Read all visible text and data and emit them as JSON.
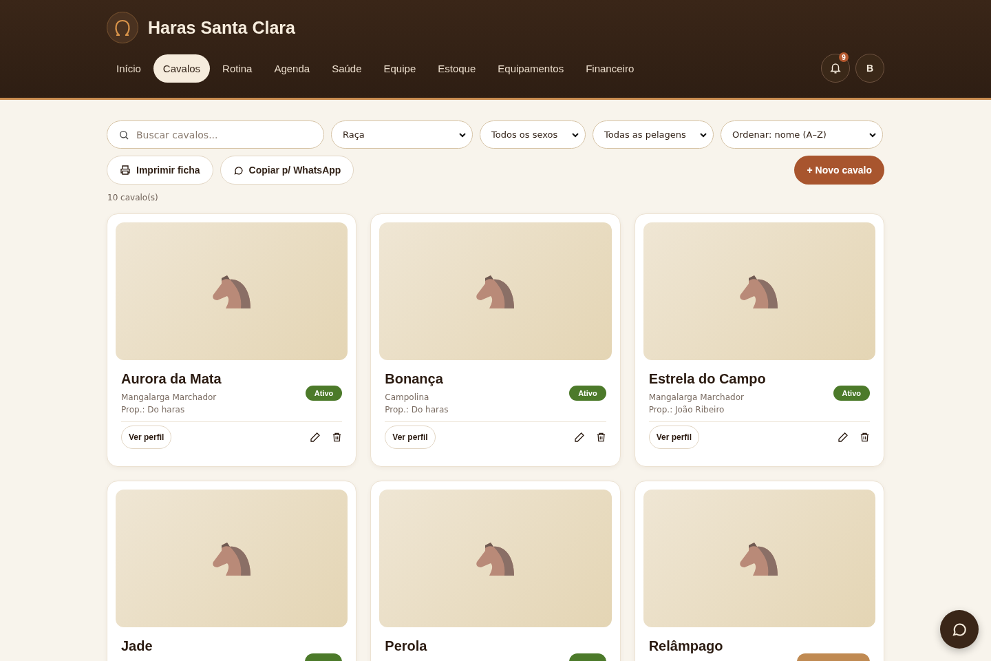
{
  "brand": {
    "title": "Haras Santa Clara"
  },
  "nav": [
    {
      "label": "Início",
      "selected": false
    },
    {
      "label": "Cavalos",
      "selected": true
    },
    {
      "label": "Rotina",
      "selected": false
    },
    {
      "label": "Agenda",
      "selected": false
    },
    {
      "label": "Saúde",
      "selected": false
    },
    {
      "label": "Equipe",
      "selected": false
    },
    {
      "label": "Estoque",
      "selected": false
    },
    {
      "label": "Equipamentos",
      "selected": false
    },
    {
      "label": "Financeiro",
      "selected": false
    }
  ],
  "notifications": {
    "count": "9"
  },
  "avatar": {
    "initial": "B"
  },
  "filters": {
    "search": {
      "placeholder": "Buscar cavalos..."
    },
    "selects": [
      {
        "value": "Raça"
      },
      {
        "value": "Todos os sexos"
      },
      {
        "value": "Todas as pelagens"
      },
      {
        "value": "Ordenar: nome (A–Z)"
      }
    ]
  },
  "actions": [
    {
      "label": "Imprimir ficha",
      "kind": "print"
    },
    {
      "label": "Copiar p/ WhatsApp",
      "kind": "chat"
    }
  ],
  "new_button": "+ Novo cavalo",
  "count": "10 cavalo(s)",
  "horses": [
    {
      "name": "Aurora da Mata",
      "breed": "Mangalarga Marchador",
      "owner": "Prop.: Do haras",
      "status": "Ativo",
      "color": "#4c7a2a",
      "view": "Ver perfil"
    },
    {
      "name": "Bonança",
      "breed": "Campolina",
      "owner": "Prop.: Do haras",
      "status": "Ativo",
      "color": "#4c7a2a",
      "view": "Ver perfil"
    },
    {
      "name": "Estrela do Campo",
      "breed": "Mangalarga Marchador",
      "owner": "Prop.: João Ribeiro",
      "status": "Ativo",
      "color": "#4c7a2a",
      "view": "Ver perfil"
    },
    {
      "name": "Jade",
      "color": "#4c7a2a"
    },
    {
      "name": "Perola",
      "color": "#4c7a2a"
    },
    {
      "name": "Relâmpago",
      "color": "#c08a52"
    }
  ]
}
